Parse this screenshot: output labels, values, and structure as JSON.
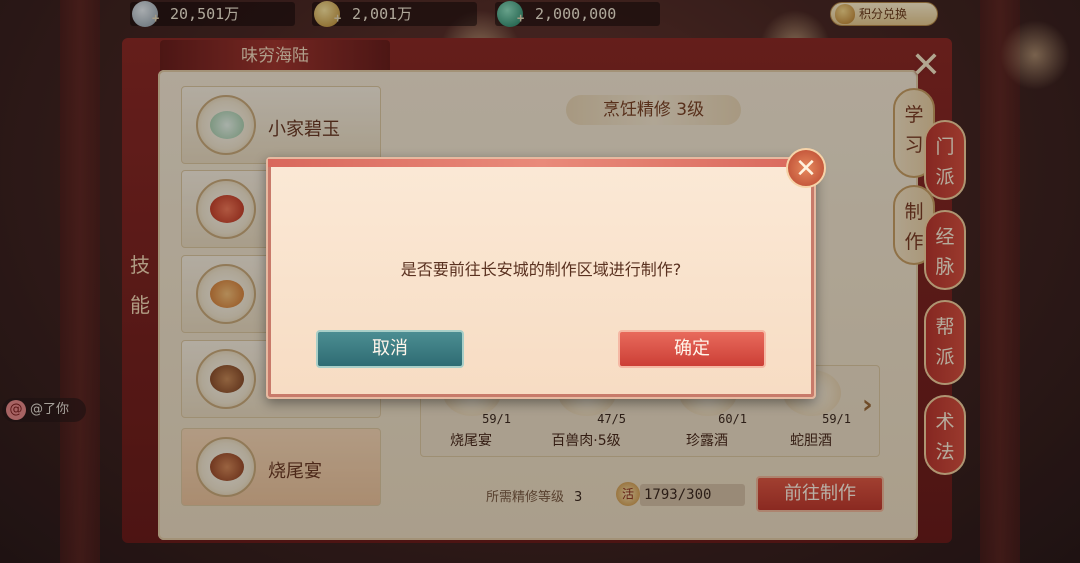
{
  "currency": {
    "silver": "20,501万",
    "gold": "2,001万",
    "jade": "2,000,000",
    "exchange_label": "积分兑换"
  },
  "panel": {
    "title": "味穷海陆",
    "side_label": "技\n能"
  },
  "recipes": [
    {
      "label": "小家碧玉"
    },
    {
      "label": ""
    },
    {
      "label": ""
    },
    {
      "label": ""
    },
    {
      "label": "烧尾宴"
    }
  ],
  "right_tabs": [
    {
      "label": "学\n习"
    },
    {
      "label": "制\n作"
    },
    {
      "label": "门\n派"
    },
    {
      "label": "经\n脉"
    },
    {
      "label": "帮\n派"
    },
    {
      "label": "术\n法"
    }
  ],
  "skill_header": "烹饪精修  3级",
  "products": [
    {
      "name": "烧尾宴",
      "count": "59/1"
    },
    {
      "name": "百兽肉·5级",
      "count": "47/5"
    },
    {
      "name": "珍露酒",
      "count": "60/1"
    },
    {
      "name": "蛇胆酒",
      "count": "59/1"
    }
  ],
  "requirement": {
    "label": "所需精修等级",
    "level": "3",
    "energy_icon": "活",
    "energy": "1793/300"
  },
  "go_button": "前往制作",
  "chat_text": "@了你",
  "modal": {
    "message": "是否要前往长安城的制作区域进行制作?",
    "cancel": "取消",
    "confirm": "确定"
  },
  "colors": {
    "panel_red": "#8c2a26",
    "parchment": "#f4e8d4",
    "confirm_red": "#cc3f36",
    "cancel_teal": "#2f6c73"
  }
}
